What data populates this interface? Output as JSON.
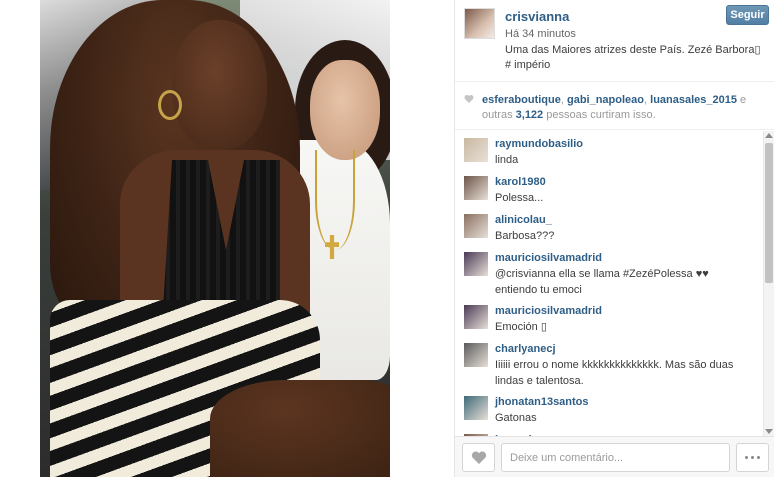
{
  "post": {
    "username": "crisvianna",
    "time_ago": "Há 34 minutos",
    "caption": "Uma das Maiores atrizes deste País. Zezé Barbora▯ # império",
    "follow_label": "Seguir"
  },
  "likes": {
    "users": [
      "esferaboutique",
      "gabi_napoleao",
      "luanasales_2015"
    ],
    "separator": ", ",
    "and_others": " e outras",
    "count": "3,122",
    "suffix": " pessoas curtiram isso."
  },
  "comments": [
    {
      "user": "raymundobasilio",
      "text": "linda",
      "avatar_color": "#c8b8a0"
    },
    {
      "user": "karol1980",
      "text": "Polessa...",
      "avatar_color": "#6d5448"
    },
    {
      "user": "alinicolau_",
      "text": "Barbosa???",
      "avatar_color": "#8a7060"
    },
    {
      "user": "mauriciosilvamadrid",
      "text": "@crisvianna ella se llama #ZezéPolessa ♥♥ entiendo tu emoci",
      "avatar_color": "#4a3a55"
    },
    {
      "user": "mauriciosilvamadrid",
      "text": "Emoción ▯",
      "avatar_color": "#4a3a55"
    },
    {
      "user": "charlyanecj",
      "text": "Iiiiii errou o nome kkkkkkkkkkkkkk. Mas são duas lindas e talentosa.",
      "avatar_color": "#5a5a5a"
    },
    {
      "user": "jhonatan13santos",
      "text": "Gatonas",
      "avatar_color": "#3e6a78"
    },
    {
      "user": "inez_ako",
      "text": "",
      "avatar_color": "#7a5a4a"
    }
  ],
  "footer": {
    "comment_placeholder": "Deixe um comentário..."
  },
  "colors": {
    "link": "#2e5e86",
    "follow_button": "#517fa4"
  },
  "icons": {
    "like": "heart-icon",
    "more": "ellipsis-icon"
  }
}
